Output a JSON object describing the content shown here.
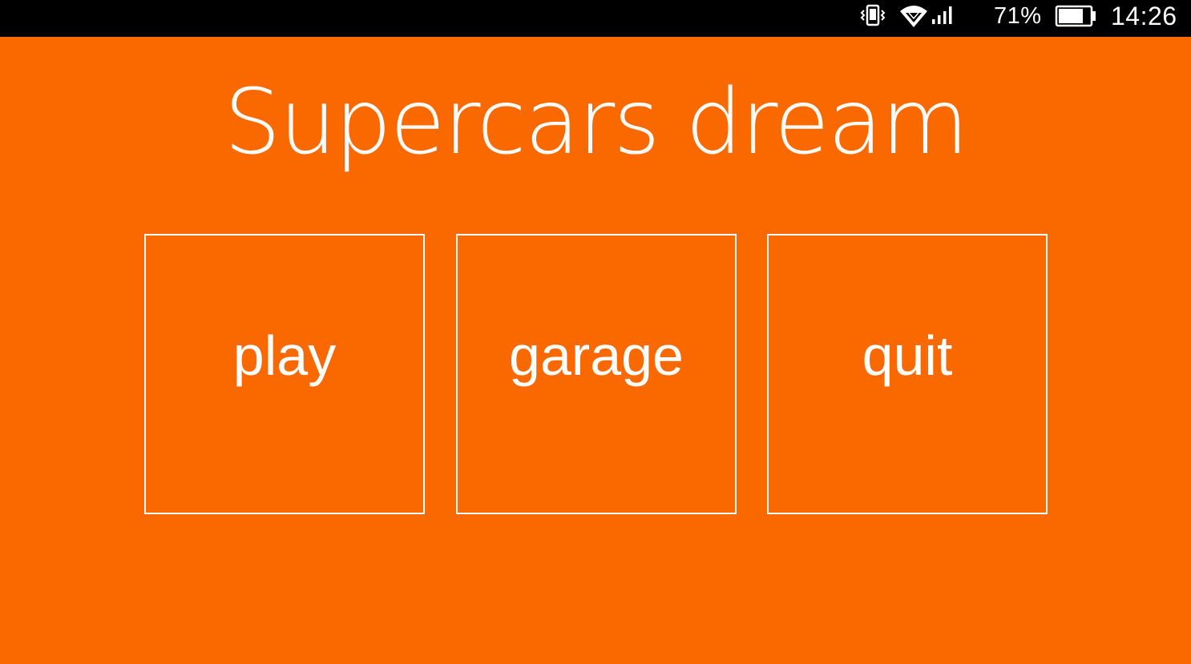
{
  "status_bar": {
    "battery_percent": "71%",
    "time": "14:26",
    "icons": [
      "vibrate-icon",
      "wifi-icon",
      "signal-icon",
      "battery-icon"
    ]
  },
  "app": {
    "title": "Supercars dream",
    "background_color": "#fa6900",
    "accent_color": "#ffffff"
  },
  "menu": {
    "items": [
      {
        "label": "play"
      },
      {
        "label": "garage"
      },
      {
        "label": "quit"
      }
    ]
  }
}
